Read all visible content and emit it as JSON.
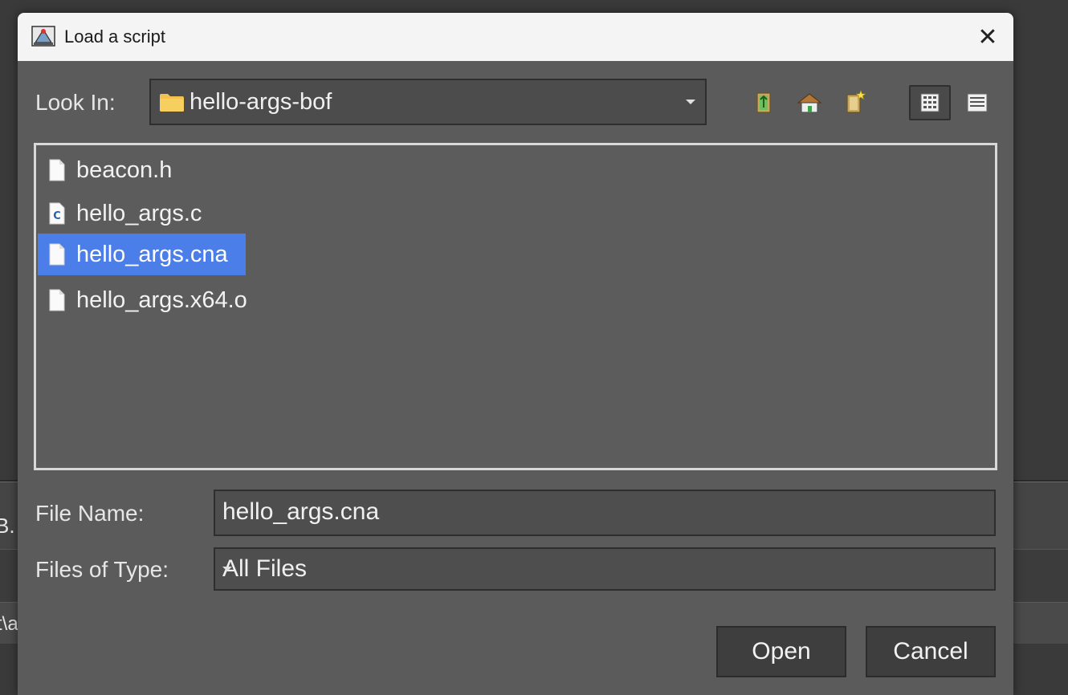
{
  "background": {
    "fragment_left": "B.",
    "fragment_path": "t\\a"
  },
  "dialog": {
    "title": "Load a script",
    "close_glyph": "✕",
    "look_in_label": "Look In:",
    "look_in_value": "hello-args-bof",
    "toolbar_icons": [
      "up-one-level-icon",
      "home-icon",
      "create-new-folder-icon",
      "list-view-icon",
      "details-view-icon"
    ],
    "files": [
      {
        "name": "beacon.h",
        "icon": "file-icon",
        "selected": false
      },
      {
        "name": "hello_args.c",
        "icon": "c-source-file-icon",
        "selected": false
      },
      {
        "name": "hello_args.cna",
        "icon": "file-icon",
        "selected": true
      },
      {
        "name": "hello_args.x64.o",
        "icon": "file-icon",
        "selected": false
      }
    ],
    "file_name_label": "File Name:",
    "file_name_value": "hello_args.cna",
    "file_type_label": "Files of Type:",
    "file_type_value": "All Files",
    "open_label": "Open",
    "cancel_label": "Cancel"
  },
  "colors": {
    "selection": "#4b7ee8",
    "dialog_bg": "#5b5b5b",
    "titlebar_bg": "#f4f4f4"
  }
}
